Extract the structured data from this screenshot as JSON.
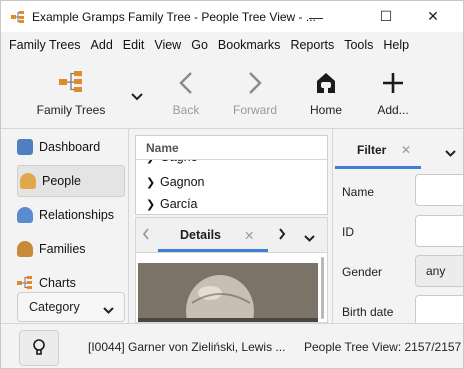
{
  "window": {
    "title": "Example Gramps Family Tree - People Tree View - ...",
    "controls": {
      "minimize": "—",
      "maximize": "☐",
      "close": "✕"
    }
  },
  "menubar": {
    "items": [
      "Family Trees",
      "Add",
      "Edit",
      "View",
      "Go",
      "Bookmarks",
      "Reports",
      "Tools",
      "Help"
    ]
  },
  "toolbar": {
    "family_trees": "Family Trees",
    "back": "Back",
    "forward": "Forward",
    "home": "Home",
    "add": "Add..."
  },
  "sidebar": {
    "items": [
      {
        "label": "Dashboard",
        "icon": "dashboard-icon"
      },
      {
        "label": "People",
        "icon": "people-icon",
        "active": true
      },
      {
        "label": "Relationships",
        "icon": "relationships-icon"
      },
      {
        "label": "Families",
        "icon": "families-icon"
      },
      {
        "label": "Charts",
        "icon": "charts-icon"
      }
    ],
    "category": "Category"
  },
  "people_list": {
    "header": "Name",
    "rows": [
      {
        "name": "Gagne",
        "partial": true
      },
      {
        "name": "Gagnon"
      },
      {
        "name": "García",
        "partial": true
      }
    ]
  },
  "details": {
    "tab": "Details"
  },
  "filter": {
    "tab": "Filter",
    "fields": [
      {
        "label": "Name",
        "kind": "text",
        "value": ""
      },
      {
        "label": "ID",
        "kind": "text",
        "value": ""
      },
      {
        "label": "Gender",
        "kind": "combo",
        "value": "any"
      },
      {
        "label": "Birth date",
        "kind": "text",
        "value": ""
      }
    ]
  },
  "statusbar": {
    "active_person": "[I0044] Garner von Zieliński, Lewis ...",
    "view_info": "People Tree View: 2157/2157"
  },
  "colors": {
    "accent": "#3c7fd6",
    "background": "#f3f3f3"
  }
}
